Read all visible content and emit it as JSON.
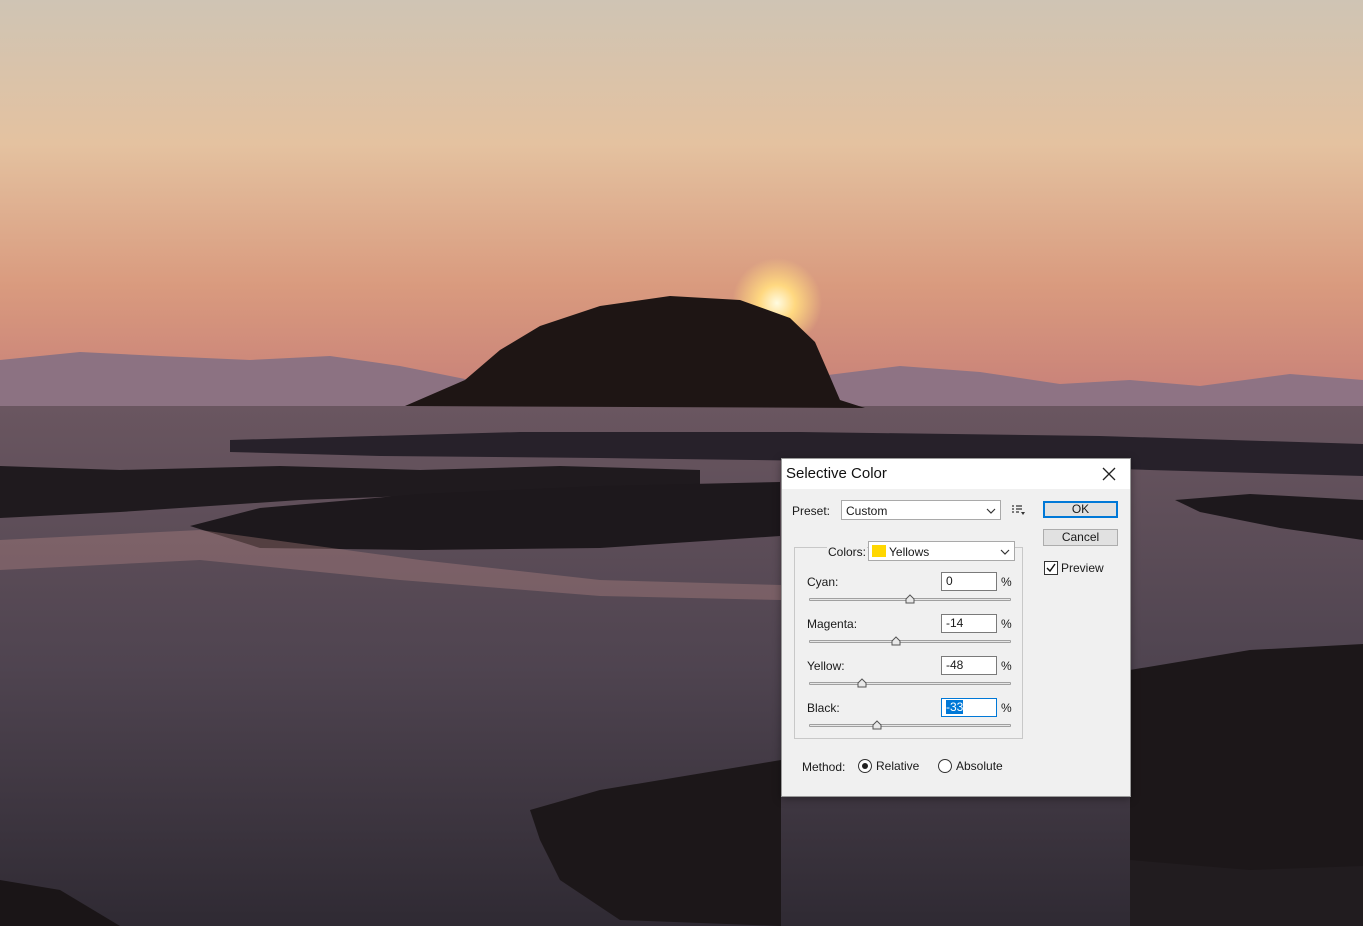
{
  "dialog": {
    "title": "Selective Color",
    "preset": {
      "label": "Preset:",
      "value": "Custom"
    },
    "colors": {
      "label": "Colors:",
      "value": "Yellows",
      "swatch_color": "#ffd700"
    },
    "sliders": [
      {
        "label": "Cyan:",
        "value": "0",
        "unit": "%",
        "level": 0
      },
      {
        "label": "Magenta:",
        "value": "-14",
        "unit": "%",
        "level": -14
      },
      {
        "label": "Yellow:",
        "value": "-48",
        "unit": "%",
        "level": -48
      },
      {
        "label": "Black:",
        "value": "-33",
        "unit": "%",
        "level": -33
      }
    ],
    "buttons": {
      "ok": "OK",
      "cancel": "Cancel"
    },
    "preview": {
      "label": "Preview",
      "checked": true
    },
    "method": {
      "label": "Method:",
      "options": [
        "Relative",
        "Absolute"
      ],
      "selected": "Relative"
    }
  },
  "colors": {
    "accent": "#0078d7"
  }
}
